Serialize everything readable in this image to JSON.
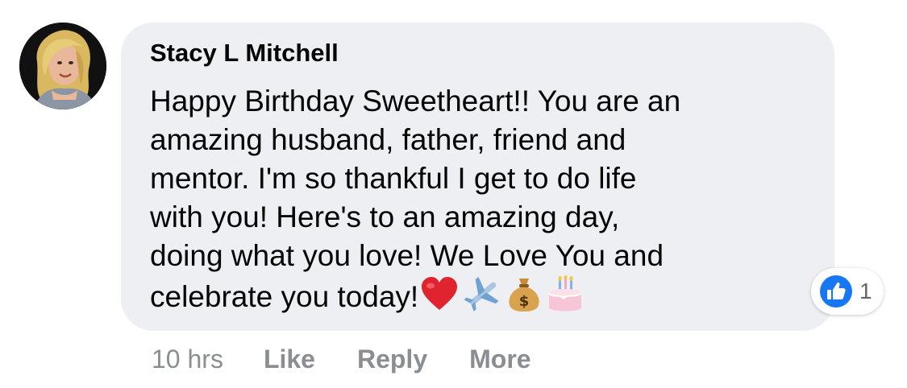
{
  "comment": {
    "author": "Stacy L Mitchell",
    "lines": [
      "Happy Birthday Sweetheart!! You are an",
      "amazing husband, father, friend and",
      "mentor. I'm so thankful I get to do life",
      "with you! Here's to an amazing day,",
      "doing what you love! We Love You and",
      "celebrate you today!"
    ],
    "emojis": [
      "red-heart-icon",
      "airplane-icon",
      "money-bag-icon",
      "birthday-cake-icon"
    ]
  },
  "reaction": {
    "icon": "like-thumb-icon",
    "count": "1",
    "color": "#1877f2"
  },
  "actions": {
    "time": "10 hrs",
    "like": "Like",
    "reply": "Reply",
    "more": "More"
  },
  "colors": {
    "bubble": "#eeeff3",
    "text": "#050505",
    "meta": "#8a8d91"
  }
}
